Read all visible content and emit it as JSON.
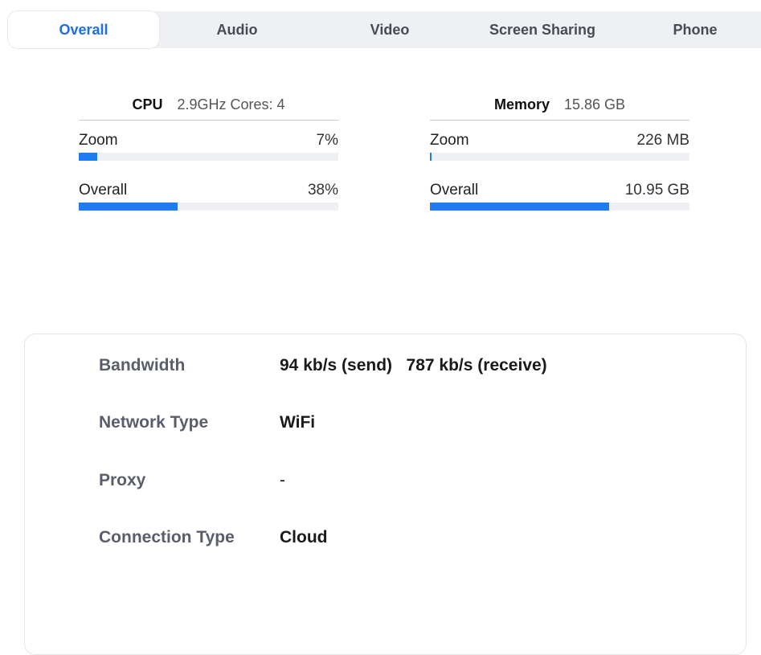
{
  "tabs": [
    {
      "label": "Overall",
      "active": true
    },
    {
      "label": "Audio",
      "active": false
    },
    {
      "label": "Video",
      "active": false
    },
    {
      "label": "Screen Sharing",
      "active": false
    },
    {
      "label": "Phone",
      "active": false
    }
  ],
  "cpu": {
    "title": "CPU",
    "spec": "2.9GHz  Cores: 4",
    "rows": [
      {
        "label": "Zoom",
        "value": "7%",
        "fraction": 0.07
      },
      {
        "label": "Overall",
        "value": "38%",
        "fraction": 0.38
      }
    ]
  },
  "memory": {
    "title": "Memory",
    "spec": "15.86 GB",
    "rows": [
      {
        "label": "Zoom",
        "value": "226 MB",
        "fraction": 0.006
      },
      {
        "label": "Overall",
        "value": "10.95 GB",
        "fraction": 0.69
      }
    ]
  },
  "network": {
    "rows": [
      {
        "key": "Bandwidth",
        "value": "94 kb/s (send)   787 kb/s (receive)"
      },
      {
        "key": "Network Type",
        "value": "WiFi"
      },
      {
        "key": "Proxy",
        "value": "-"
      },
      {
        "key": "Connection Type",
        "value": "Cloud"
      }
    ]
  },
  "colors": {
    "accent": "#1f7cf0",
    "tab_active_text": "#1f6fe0",
    "track": "#eef0f3"
  }
}
